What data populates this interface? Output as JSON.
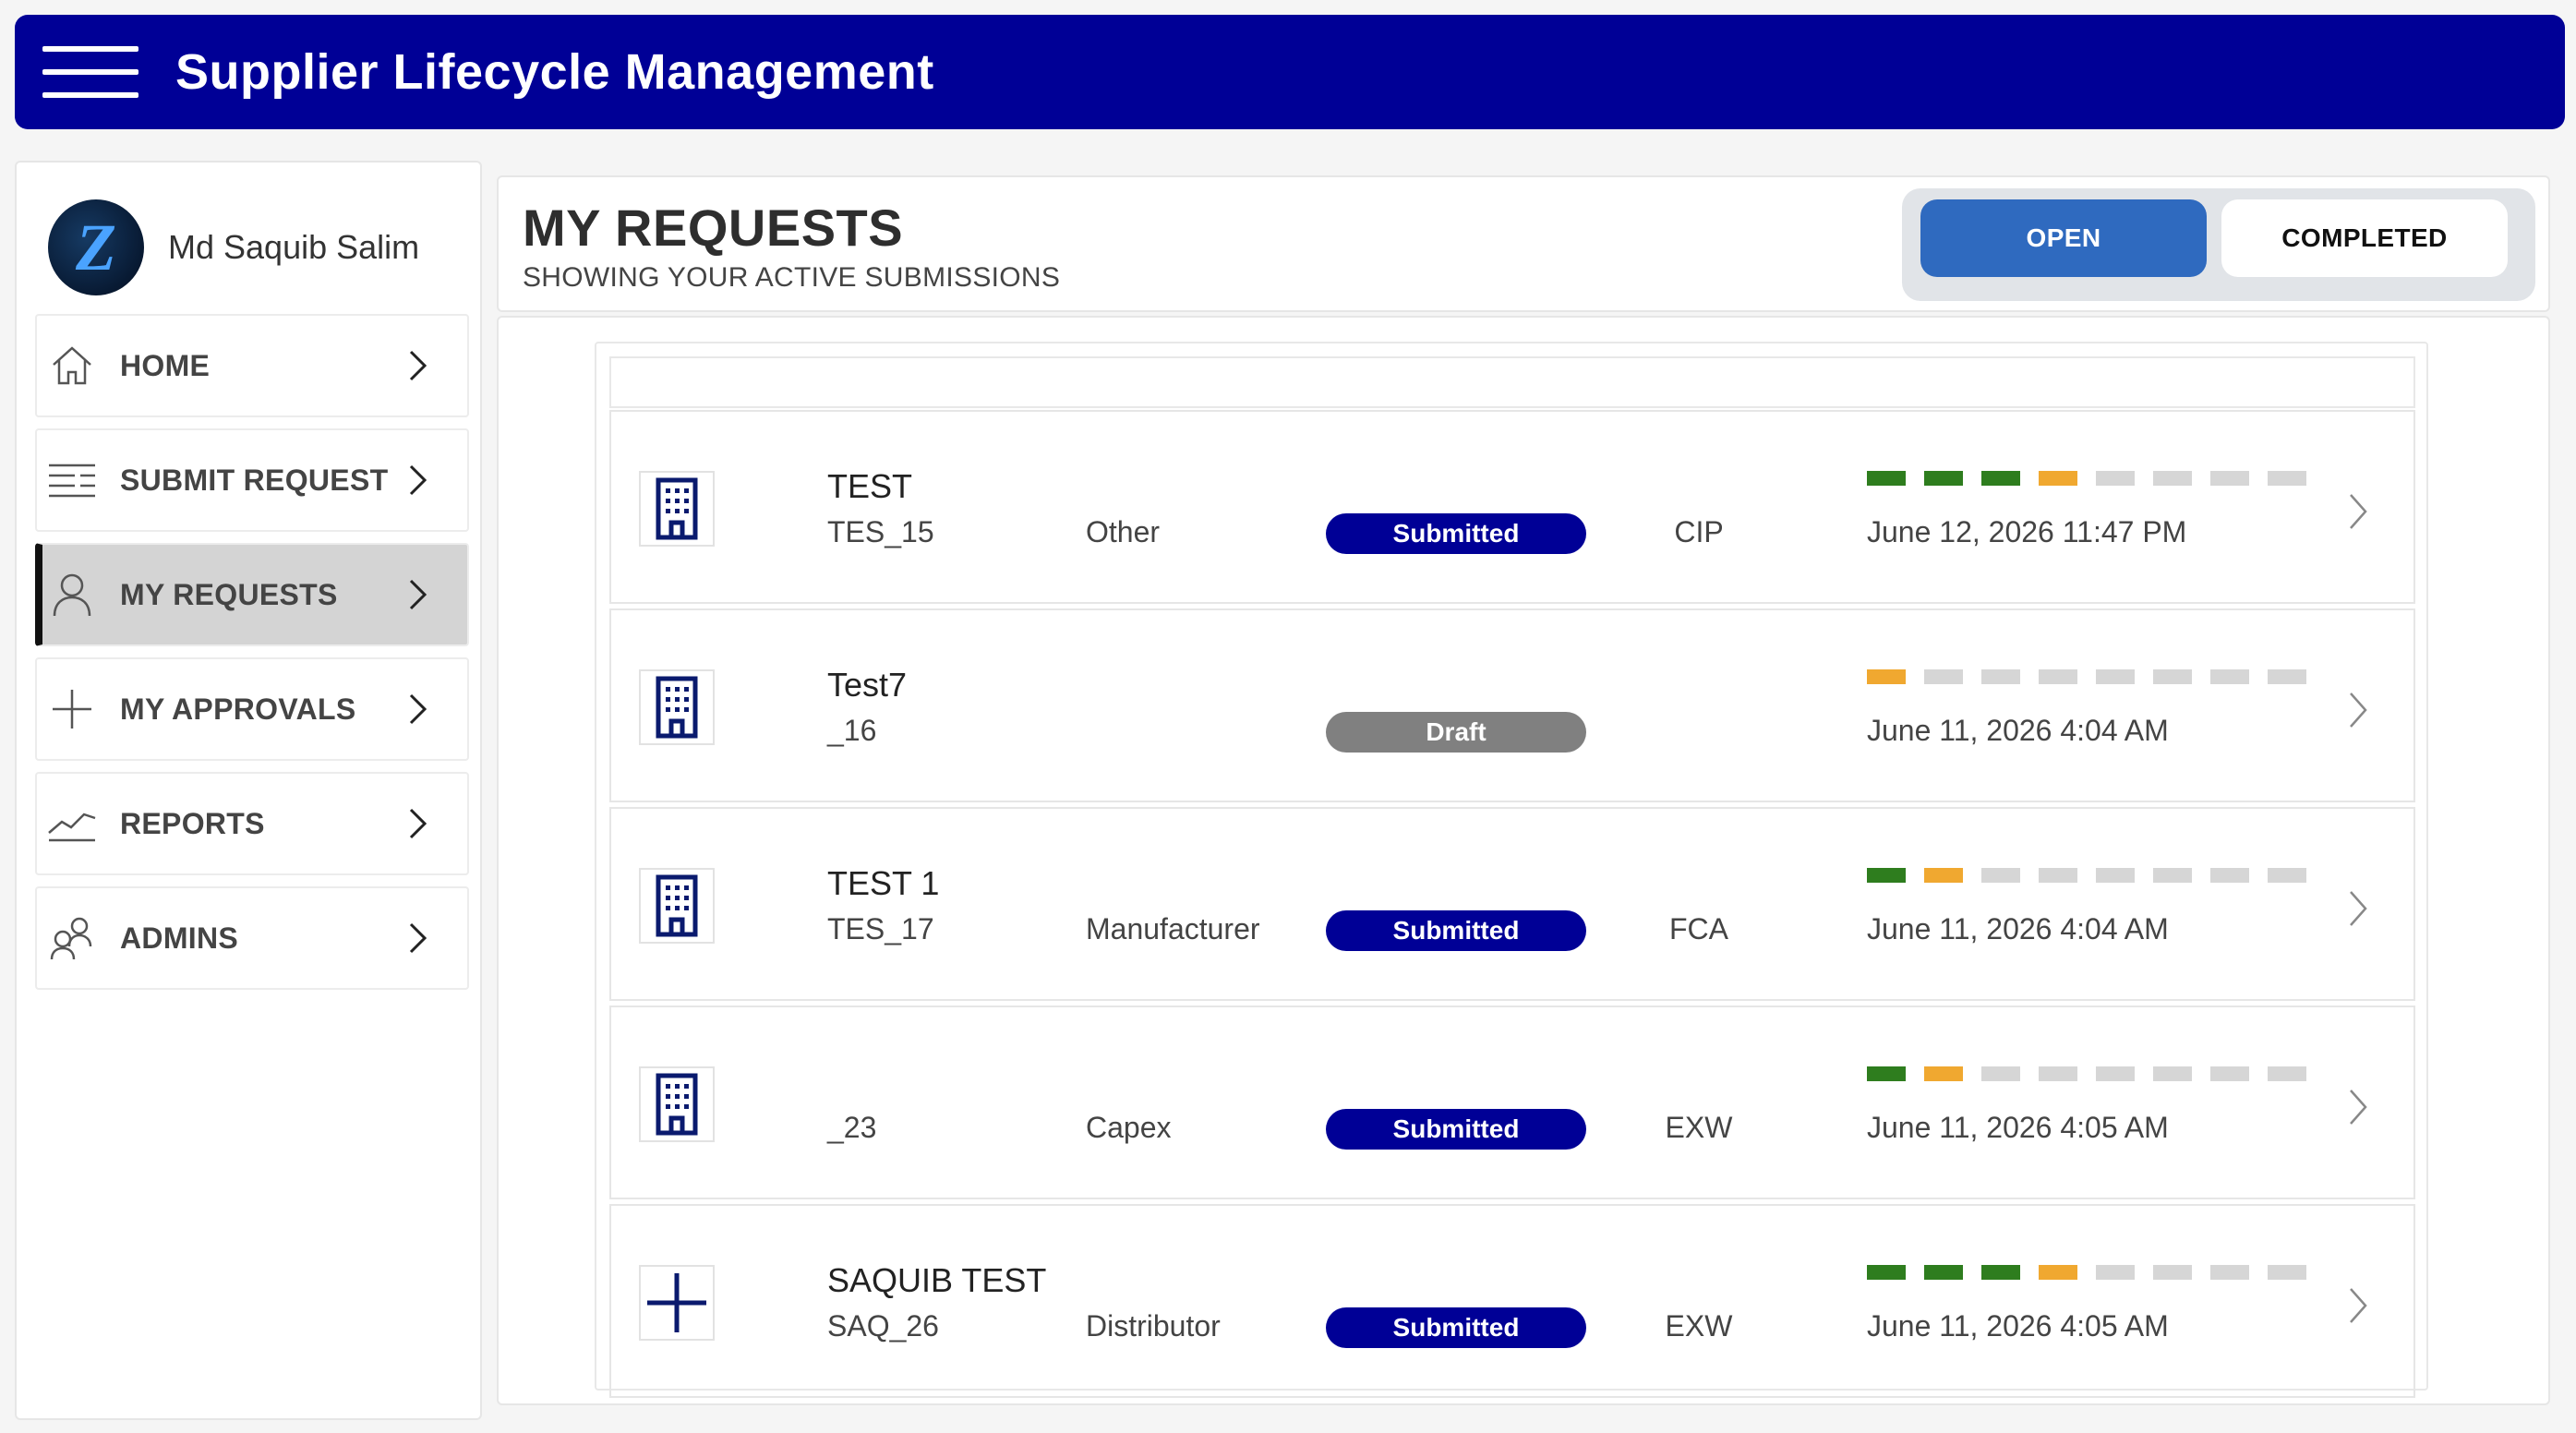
{
  "app": {
    "title": "Supplier Lifecycle Management"
  },
  "user": {
    "name": "Md Saquib Salim",
    "avatar_letter": "Z"
  },
  "nav": [
    {
      "label": "HOME",
      "icon": "home-icon"
    },
    {
      "label": "SUBMIT REQUEST",
      "icon": "list-icon"
    },
    {
      "label": "MY REQUESTS",
      "icon": "person-icon",
      "active": true
    },
    {
      "label": "MY APPROVALS",
      "icon": "plus-icon"
    },
    {
      "label": "REPORTS",
      "icon": "trend-chart-icon"
    },
    {
      "label": "ADMINS",
      "icon": "people-icon"
    }
  ],
  "page": {
    "title": "MY REQUESTS",
    "subtitle": "SHOWING YOUR ACTIVE SUBMISSIONS",
    "toggle": {
      "open": "OPEN",
      "completed": "COMPLETED",
      "selected": "open"
    }
  },
  "colors": {
    "header": "#000096",
    "submitted": "#000096",
    "draft": "#808080",
    "progress_done": "#2e7d1e",
    "progress_current": "#f0a830",
    "progress_pending": "#d6d6d6",
    "toggle_active": "#2f6abf"
  },
  "requests": [
    {
      "title": "TEST",
      "code": "TES_15",
      "type": "Other",
      "status": "Submitted",
      "incoterm": "CIP",
      "date": "June 12, 2026 11:47 PM",
      "progress": [
        "done",
        "done",
        "done",
        "current",
        "pending",
        "pending",
        "pending",
        "pending"
      ],
      "icon": "building-icon"
    },
    {
      "title": "Test7",
      "code": "_16",
      "type": "",
      "status": "Draft",
      "incoterm": "",
      "date": "June 11, 2026 4:04 AM",
      "progress": [
        "current",
        "pending",
        "pending",
        "pending",
        "pending",
        "pending",
        "pending",
        "pending"
      ],
      "icon": "building-icon"
    },
    {
      "title": "TEST 1",
      "code": "TES_17",
      "type": "Manufacturer",
      "status": "Submitted",
      "incoterm": "FCA",
      "date": "June 11, 2026 4:04 AM",
      "progress": [
        "done",
        "current",
        "pending",
        "pending",
        "pending",
        "pending",
        "pending",
        "pending"
      ],
      "icon": "building-icon"
    },
    {
      "title": "",
      "code": "_23",
      "type": "Capex",
      "status": "Submitted",
      "incoterm": "EXW",
      "date": "June 11, 2026 4:05 AM",
      "progress": [
        "done",
        "current",
        "pending",
        "pending",
        "pending",
        "pending",
        "pending",
        "pending"
      ],
      "icon": "building-icon"
    },
    {
      "title": "SAQUIB TEST",
      "code": "SAQ_26",
      "type": "Distributor",
      "status": "Submitted",
      "incoterm": "EXW",
      "date": "June 11, 2026 4:05 AM",
      "progress": [
        "done",
        "done",
        "done",
        "current",
        "pending",
        "pending",
        "pending",
        "pending"
      ],
      "icon": "plus-icon"
    }
  ]
}
